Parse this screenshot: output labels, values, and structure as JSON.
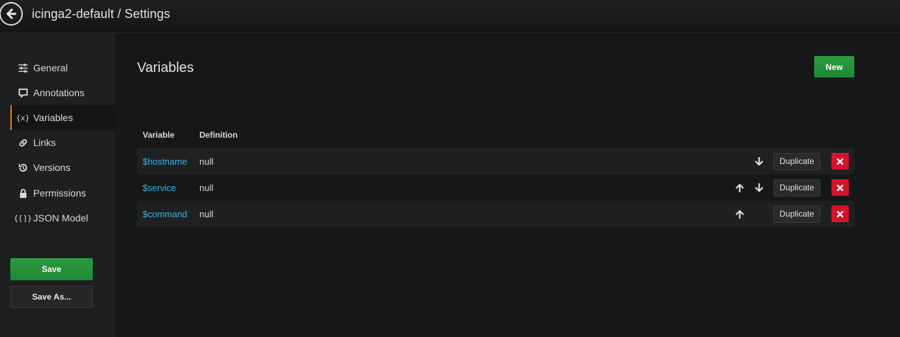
{
  "header": {
    "title": "icinga2-default / Settings"
  },
  "sidebar": {
    "items": [
      {
        "label": "General",
        "icon": "sliders-icon"
      },
      {
        "label": "Annotations",
        "icon": "comment-icon"
      },
      {
        "label": "Variables",
        "icon": "variable-icon",
        "icon_text": "{x}",
        "active": true
      },
      {
        "label": "Links",
        "icon": "link-icon"
      },
      {
        "label": "Versions",
        "icon": "history-icon"
      },
      {
        "label": "Permissions",
        "icon": "lock-icon"
      },
      {
        "label": "JSON Model",
        "icon": "json-icon",
        "icon_text": "{[]}"
      }
    ],
    "save_label": "Save",
    "save_as_label": "Save As..."
  },
  "main": {
    "title": "Variables",
    "new_label": "New",
    "columns": [
      "Variable",
      "Definition"
    ],
    "rows": [
      {
        "name": "$hostname",
        "definition": "null",
        "move_up": false,
        "move_down": true
      },
      {
        "name": "$service",
        "definition": "null",
        "move_up": true,
        "move_down": true
      },
      {
        "name": "$command",
        "definition": "null",
        "move_up": true,
        "move_down": false
      }
    ],
    "duplicate_label": "Duplicate"
  },
  "colors": {
    "accent": "#eb7b18",
    "primary": "#299c46",
    "danger": "#d5132a",
    "link": "#33b5e5"
  }
}
